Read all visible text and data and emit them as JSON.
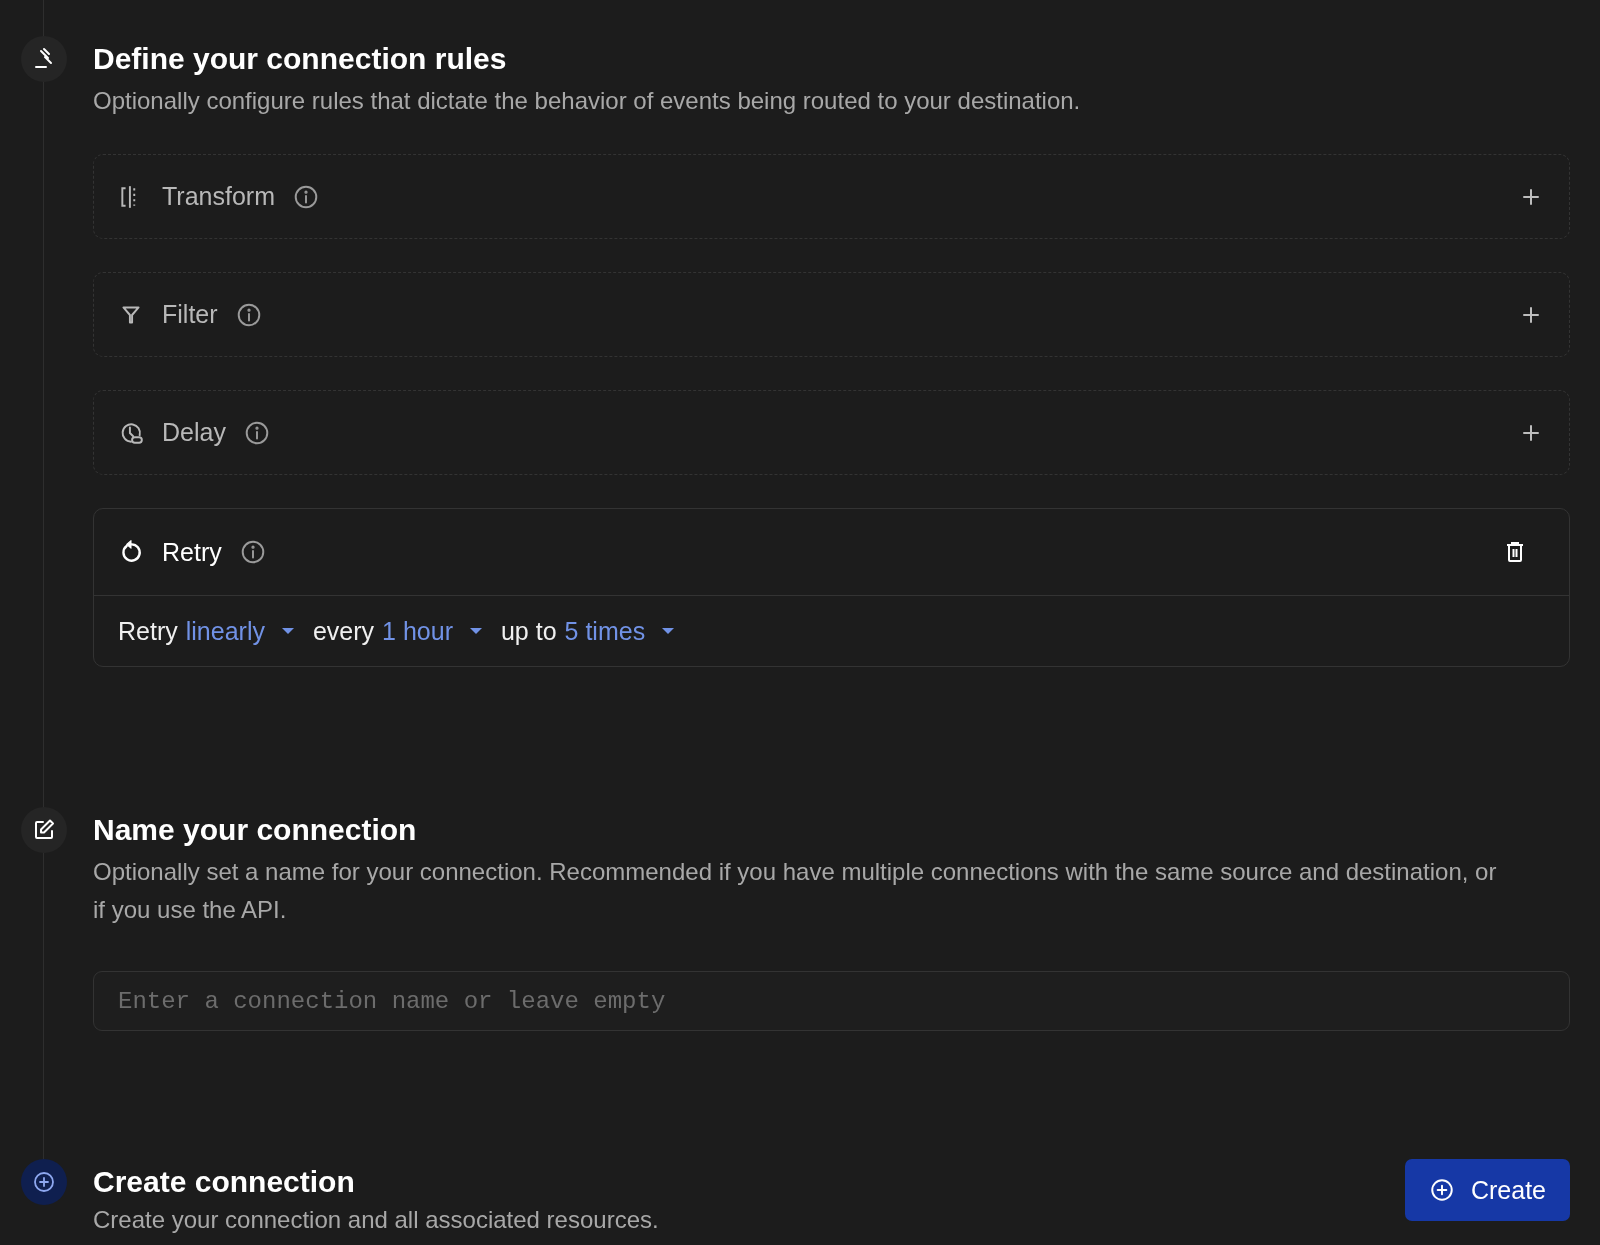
{
  "steps": [
    {
      "kind": "rules",
      "title": "Define your connection rules",
      "description": "Optionally configure rules that dictate the behavior of events being routed to your destination.",
      "rules": [
        {
          "kind": "transform",
          "label": "Transform",
          "active": false
        },
        {
          "kind": "filter",
          "label": "Filter",
          "active": false
        },
        {
          "kind": "delay",
          "label": "Delay",
          "active": false
        },
        {
          "kind": "retry",
          "label": "Retry",
          "active": true,
          "sentence": [
            {
              "kind": "text",
              "text": "Retry"
            },
            {
              "kind": "select",
              "text": "linearly"
            },
            {
              "kind": "text",
              "text": "every"
            },
            {
              "kind": "select",
              "text": "1 hour"
            },
            {
              "kind": "text",
              "text": "up to"
            },
            {
              "kind": "select",
              "text": "5 times"
            }
          ]
        }
      ]
    },
    {
      "kind": "name",
      "title": "Name your connection",
      "description": "Optionally set a name for your connection. Recommended if you have multiple connections with the same source and destination, or if you use the API.",
      "field": {
        "placeholder": "Enter a connection name or leave empty"
      }
    },
    {
      "kind": "create",
      "title": "Create connection",
      "description": "Create your connection and all associated resources.",
      "button": "Create"
    }
  ]
}
